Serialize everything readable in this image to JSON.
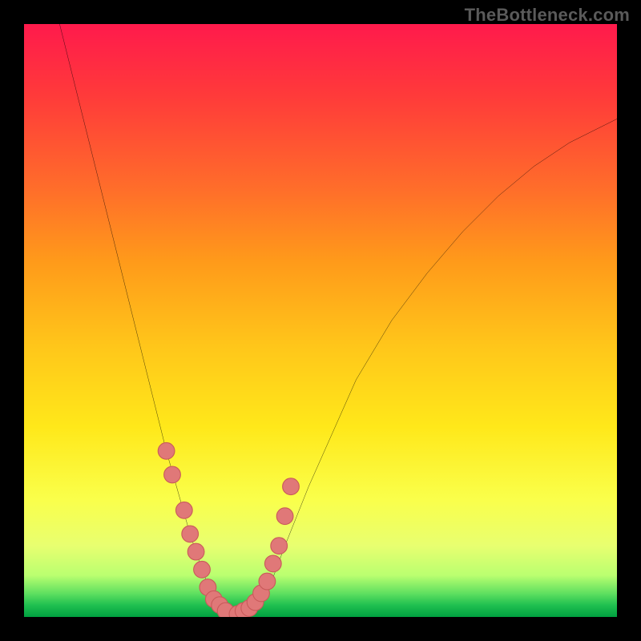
{
  "watermark": "TheBottleneck.com",
  "colors": {
    "frame": "#000000",
    "gradient_top": "#ff1a4c",
    "gradient_bottom": "#00a040",
    "curve": "#000000",
    "marker_fill": "#e07878",
    "marker_stroke": "#c95a5a"
  },
  "chart_data": {
    "type": "line",
    "title": "",
    "xlabel": "",
    "ylabel": "",
    "xlim": [
      0,
      100
    ],
    "ylim": [
      0,
      100
    ],
    "grid": false,
    "legend": false,
    "annotations": [],
    "series": [
      {
        "name": "curve",
        "x": [
          6,
          8,
          10,
          12,
          14,
          16,
          18,
          20,
          22,
          24,
          26,
          28,
          30,
          32,
          34,
          36,
          38,
          41,
          44,
          48,
          52,
          56,
          62,
          68,
          74,
          80,
          86,
          92,
          98,
          100
        ],
        "y": [
          100,
          92,
          84,
          76,
          68,
          60,
          52,
          44,
          36,
          28,
          21,
          14,
          8,
          3,
          1,
          0.5,
          1,
          4,
          12,
          22,
          31,
          40,
          50,
          58,
          65,
          71,
          76,
          80,
          83,
          84
        ]
      },
      {
        "name": "markers-left",
        "x": [
          24,
          25,
          27,
          28,
          29,
          30,
          31,
          32,
          33,
          34
        ],
        "y": [
          28,
          24,
          18,
          14,
          11,
          8,
          5,
          3,
          2,
          1
        ]
      },
      {
        "name": "markers-right",
        "x": [
          36,
          37,
          38,
          39,
          40,
          41,
          42,
          43,
          44,
          45
        ],
        "y": [
          0.5,
          1,
          1.5,
          2.5,
          4,
          6,
          9,
          12,
          17,
          22
        ]
      }
    ]
  }
}
